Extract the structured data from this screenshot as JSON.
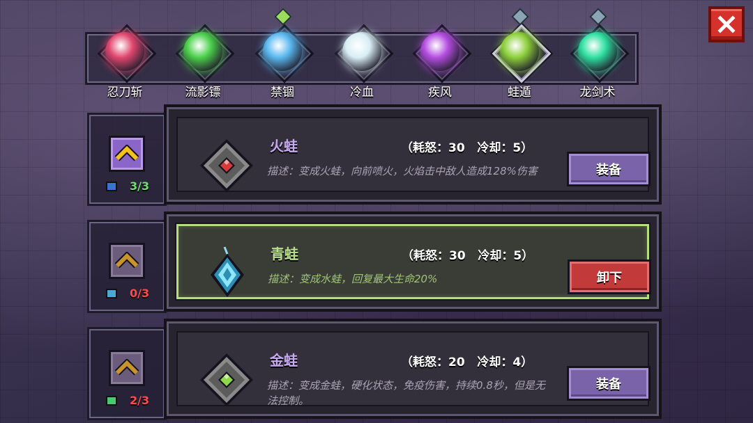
{
  "close_label": "close",
  "skills": [
    {
      "label": "忍刀斩",
      "icon": "crimson-slash-orb-icon",
      "color": "#e0466e",
      "gem": false,
      "selected": false
    },
    {
      "label": "流影镖",
      "icon": "green-shuriken-orb-icon",
      "color": "#4bd04b",
      "gem": false,
      "selected": false
    },
    {
      "label": "禁锢",
      "icon": "blue-ice-orb-icon",
      "color": "#5ab8f0",
      "gem": true,
      "gem_color": "green",
      "selected": false
    },
    {
      "label": "冷血",
      "icon": "white-crystal-burst-icon",
      "color": "#d8eef4",
      "gem": false,
      "selected": false
    },
    {
      "label": "疾风",
      "icon": "purple-flame-orb-icon",
      "color": "#b44de0",
      "gem": false,
      "selected": false
    },
    {
      "label": "蛙遁",
      "icon": "blue-frog-icon",
      "color": "#8ccf3a",
      "gem": true,
      "gem_color": "blue",
      "selected": true
    },
    {
      "label": "龙剑术",
      "icon": "green-sword-burst-icon",
      "color": "#2ee0a0",
      "gem": true,
      "gem_color": "blue",
      "selected": false
    }
  ],
  "rows": [
    {
      "name": "火蛙",
      "stats": "（耗怒：30   冷却：5）",
      "desc": "描述：变成火蛙，向前喷火，火焰击中敌人造成128%伤害",
      "button": "装备",
      "state": "equip",
      "level": "3/3",
      "level_color": "#6ee06e",
      "upgrade_active": true,
      "icon": "red-diamond-gem-icon",
      "gem_color": "#d83a3a",
      "level_icon_color": "#3a74d0"
    },
    {
      "name": "青蛙",
      "stats": "（耗怒：30   冷却：5）",
      "desc": "描述：变成水蛙，回复最大生命20%",
      "button": "卸下",
      "state": "unequip",
      "level": "0/3",
      "level_color": "#ff4a4a",
      "upgrade_active": false,
      "icon": "cyan-crystal-pendant-icon",
      "gem_color": "#52c8e8",
      "level_icon_color": "#4aa8d8"
    },
    {
      "name": "金蛙",
      "stats": "（耗怒：20   冷却：4）",
      "desc": "描述：变成金蛙，硬化状态，免疫伤害，持续0.8秒，但是无法控制。",
      "button": "装备",
      "state": "equip",
      "level": "2/3",
      "level_color": "#ff4a4a",
      "upgrade_active": false,
      "icon": "green-diamond-gem-icon",
      "gem_color": "#8fd84a",
      "level_icon_color": "#4ac870"
    }
  ]
}
